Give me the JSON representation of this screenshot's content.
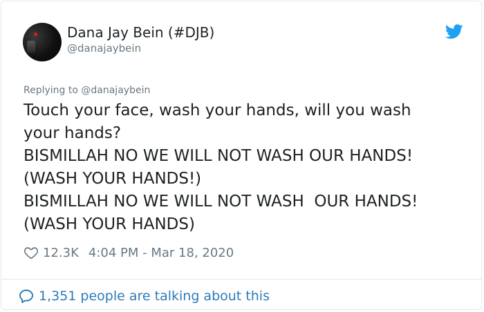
{
  "author": {
    "name": "Dana Jay Bein (#DJB)",
    "handle": "@danajaybein"
  },
  "reply": {
    "prefix": "Replying to ",
    "mention": "@danajaybein"
  },
  "tweet": {
    "lines": [
      "Touch your face, wash your hands, will you wash",
      "your hands?",
      "BISMILLAH NO WE WILL NOT WASH OUR HANDS!",
      "(WASH YOUR HANDS!)",
      "BISMILLAH NO WE WILL NOT WASH  OUR HANDS!",
      "(WASH YOUR HANDS)"
    ]
  },
  "meta": {
    "likes": "12.3K",
    "timestamp": "4:04 PM - Mar 18, 2020"
  },
  "footer": {
    "talking": "1,351 people are talking about this"
  },
  "colors": {
    "twitter_blue": "#1da1f2",
    "link_blue": "#2b7bb9",
    "muted": "#697882",
    "text": "#1c2022"
  },
  "icons": {
    "brand": "twitter-bird-icon",
    "like": "heart-icon",
    "conversation": "speech-bubble-icon"
  }
}
